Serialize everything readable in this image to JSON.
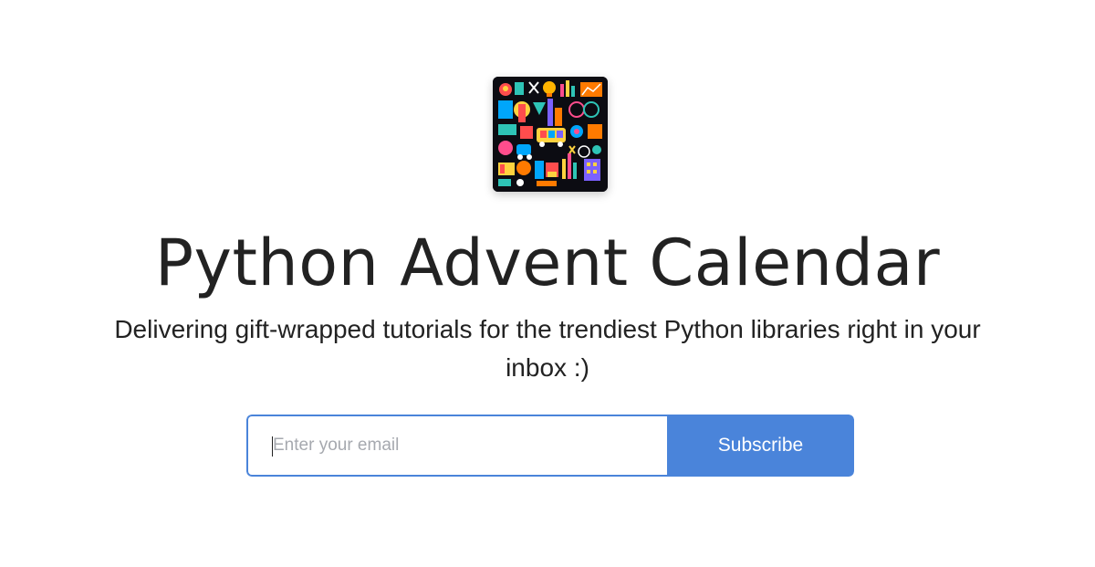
{
  "header": {
    "logo_name": "python-advent-calendar-logo"
  },
  "hero": {
    "title": "Python Advent Calendar",
    "subtitle": "Delivering gift-wrapped tutorials for the trendiest Python libraries right in your inbox :)"
  },
  "signup": {
    "email_placeholder": "Enter your email",
    "email_value": "",
    "subscribe_label": "Subscribe"
  },
  "colors": {
    "accent": "#4a84da",
    "text": "#222222",
    "background": "#ffffff",
    "placeholder": "#a6a9af"
  }
}
